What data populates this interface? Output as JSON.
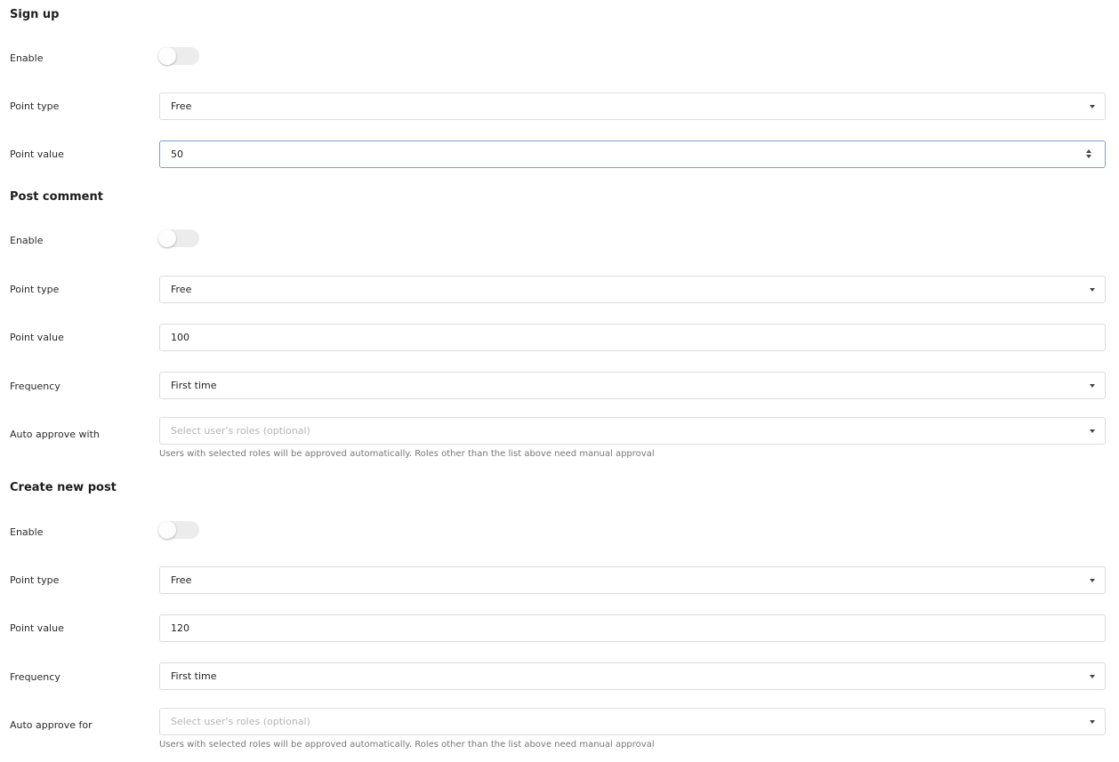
{
  "sections": [
    {
      "title": "Sign up",
      "enable_label": "Enable",
      "enabled": false,
      "point_type_label": "Point type",
      "point_type_value": "Free",
      "point_value_label": "Point value",
      "point_value": "50"
    },
    {
      "title": "Post comment",
      "enable_label": "Enable",
      "enabled": false,
      "point_type_label": "Point type",
      "point_type_value": "Free",
      "point_value_label": "Point value",
      "point_value": "100",
      "frequency_label": "Frequency",
      "frequency_value": "First time",
      "auto_approve_label": "Auto approve with",
      "auto_approve_placeholder": "Select user's roles (optional)",
      "auto_approve_help": "Users with selected roles will be approved automatically. Roles other than the list above need manual approval"
    },
    {
      "title": "Create new post",
      "enable_label": "Enable",
      "enabled": false,
      "point_type_label": "Point type",
      "point_type_value": "Free",
      "point_value_label": "Point value",
      "point_value": "120",
      "frequency_label": "Frequency",
      "frequency_value": "First time",
      "auto_approve_label": "Auto approve for",
      "auto_approve_placeholder": "Select user's roles (optional)",
      "auto_approve_help": "Users with selected roles will be approved automatically. Roles other than the list above need manual approval"
    }
  ]
}
